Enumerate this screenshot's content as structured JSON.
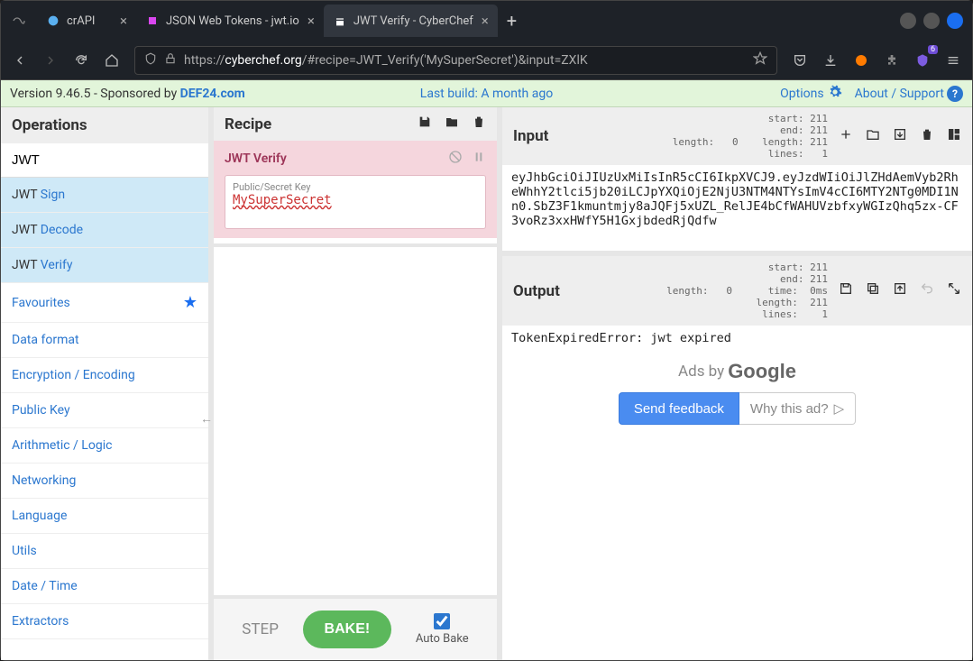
{
  "browser": {
    "tabs": [
      {
        "title": "crAPI",
        "active": false
      },
      {
        "title": "JSON Web Tokens - jwt.io",
        "active": false
      },
      {
        "title": "JWT Verify - CyberChef",
        "active": true
      }
    ],
    "url_pre": "https://",
    "url_host": "cyberchef.org",
    "url_rest": "/#recipe=JWT_Verify('MySuperSecret')&input=ZXlK"
  },
  "topbar": {
    "version_label": "Version 9.46.5",
    "sponsored_by": " - Sponsored by ",
    "sponsor": "DEF24.com",
    "last_build": "Last build: A month ago",
    "options": "Options",
    "about": "About / Support"
  },
  "operations": {
    "title": "Operations",
    "search_value": "JWT",
    "results": [
      {
        "prefix": "JWT",
        "rest": " Sign"
      },
      {
        "prefix": "JWT",
        "rest": " Decode"
      },
      {
        "prefix": "JWT",
        "rest": " Verify"
      }
    ],
    "categories": [
      "Favourites",
      "Data format",
      "Encryption / Encoding",
      "Public Key",
      "Arithmetic / Logic",
      "Networking",
      "Language",
      "Utils",
      "Date / Time",
      "Extractors"
    ]
  },
  "recipe": {
    "title": "Recipe",
    "op_name": "JWT Verify",
    "key_label": "Public/Secret Key",
    "key_value": "MySuperSecret",
    "step_label": "STEP",
    "bake_label": "BAKE!",
    "autobake_label": "Auto Bake",
    "autobake_checked": true
  },
  "input": {
    "title": "Input",
    "stats_left": " start: 211\n   end: 211\nlength:   0",
    "stats_right": "length: 211\n lines:   1",
    "text": "eyJhbGciOiJIUzUxMiIsInR5cCI6IkpXVCJ9.eyJzdWIiOiJlZHdAemVyb2RheWhhY2tlci5jb20iLCJpYXQiOjE2NjU3NTM4NTYsImV4cCI6MTY2NTg0MDI1Nn0.SbZ3F1kmuntmjy8aJQFj5xUZL_RelJE4bCfWAHUVzbfxyWGIzQhq5zx-CF3voRz3xxHWfY5H1GxjbdedRjQdfw"
  },
  "output": {
    "title": "Output",
    "stats_left": " start: 211\n   end: 211\nlength:   0",
    "stats_right": "  time:  0ms\nlength:  211\n lines:    1",
    "text": "TokenExpiredError: jwt expired"
  },
  "ads": {
    "ads_by": "Ads by",
    "google": "Google",
    "send_feedback": "Send feedback",
    "why_this_ad": "Why this ad?"
  }
}
